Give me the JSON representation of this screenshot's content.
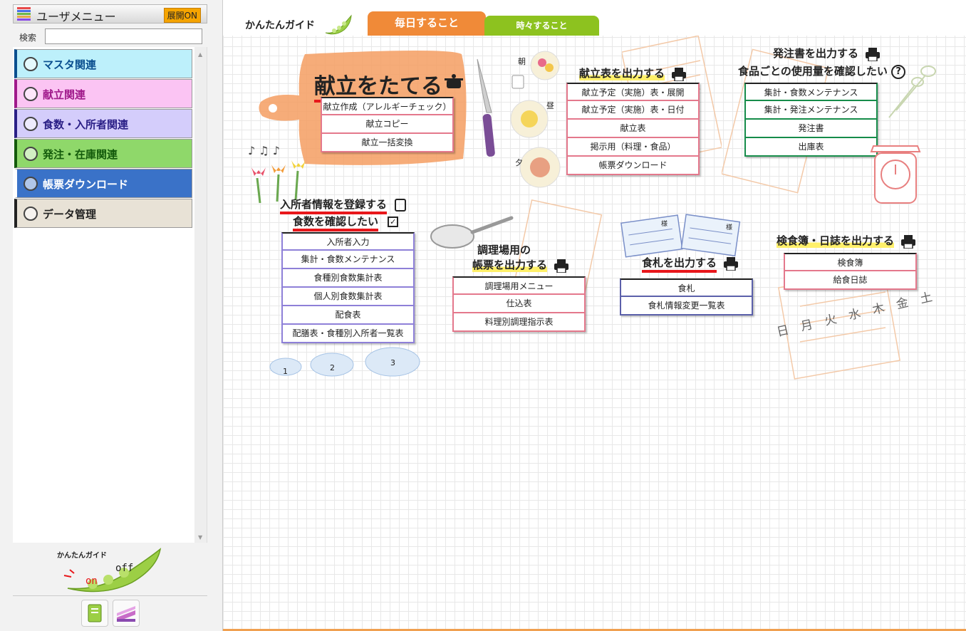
{
  "sidebar": {
    "title": "ユーザメニュー",
    "expand_label": "展開ON",
    "search_label": "検索",
    "search_value": "",
    "categories": [
      {
        "label": "マスタ関連",
        "bg": "#bdf0fb",
        "color": "#0a4f8f"
      },
      {
        "label": "献立関連",
        "bg": "#fbc4f3",
        "color": "#a01a8b"
      },
      {
        "label": "食数・入所者関連",
        "bg": "#d4cdfb",
        "color": "#2a1f86"
      },
      {
        "label": "発注・在庫関連",
        "bg": "#8fd86a",
        "color": "#135a0b"
      },
      {
        "label": "帳票ダウンロード",
        "bg": "#3a72c8",
        "color": "#ffffff"
      },
      {
        "label": "データ管理",
        "bg": "#e8e2d6",
        "color": "#222222"
      }
    ],
    "logo_text": "かんたんガイド",
    "logo_on": "on",
    "logo_off": "off"
  },
  "main": {
    "guide_title": "かんたんガイド",
    "tabs": [
      {
        "label": "毎日すること",
        "active": true
      },
      {
        "label": "時々すること",
        "active": false
      }
    ],
    "groups": {
      "kondate_make": {
        "title": "献立をたてる",
        "buttons": [
          "献立作成（アレルギーチェック）",
          "献立コピー",
          "献立一括変換"
        ]
      },
      "kondate_print": {
        "title": "献立表を出力する",
        "buttons": [
          "献立予定（実施）表・展開",
          "献立予定（実施）表・日付",
          "献立表",
          "掲示用（料理・食品）",
          "帳票ダウンロード"
        ]
      },
      "order": {
        "title1": "発注書を出力する",
        "title2": "食品ごとの使用量を確認したい",
        "buttons": [
          "集計・食数メンテナンス",
          "集計・発注メンテナンス",
          "発注書",
          "出庫表"
        ]
      },
      "resident": {
        "title1": "入所者情報を登録する",
        "title2": "食数を確認したい",
        "buttons": [
          "入所者入力",
          "集計・食数メンテナンス",
          "食種別食数集計表",
          "個人別食数集計表",
          "配食表",
          "配膳表・食種別入所者一覧表"
        ]
      },
      "kitchen": {
        "title1": "調理場用の",
        "title2": "帳票を出力する",
        "buttons": [
          "調理場用メニュー",
          "仕込表",
          "料理別調理指示表"
        ]
      },
      "tag": {
        "title": "食札を出力する",
        "buttons": [
          "食札",
          "食札情報変更一覧表"
        ]
      },
      "inspect": {
        "title": "検食簿・日誌を出力する",
        "buttons": [
          "検食簿",
          "給食日誌"
        ]
      }
    },
    "deco": {
      "meal_labels": [
        "朝",
        "昼",
        "夕"
      ],
      "bowl_numbers": [
        "1",
        "2",
        "3"
      ],
      "weekdays": "日 月 火 水 木 金 土",
      "tag_label": "様"
    }
  }
}
